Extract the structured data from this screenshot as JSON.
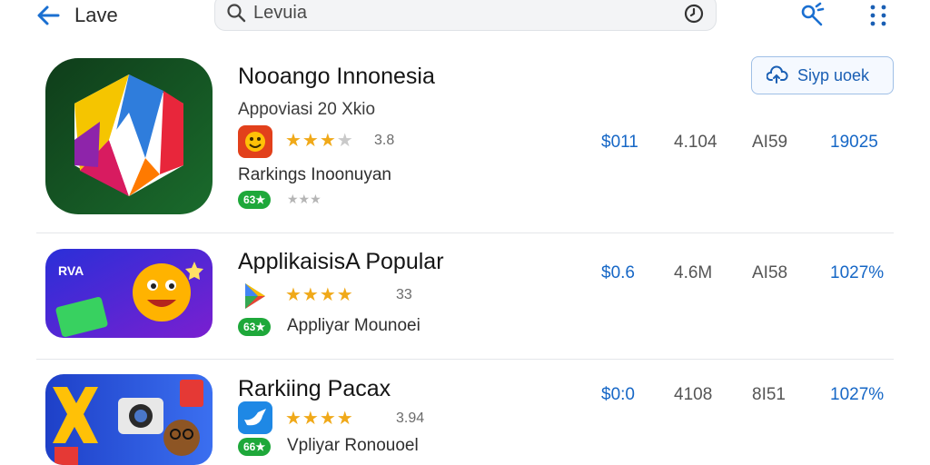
{
  "header": {
    "back_label": "Lave",
    "search": {
      "value": "Levuia",
      "placeholder": ""
    },
    "accent": "#1a6fd1"
  },
  "apps": [
    {
      "title": "Nooango Innonesia",
      "subtitle": "Appoviasi 20 Xkio",
      "rating": "3.8",
      "stars": 3.5,
      "line_label": "Rarkings Inoonuyan",
      "badge": "63★",
      "action_label": "Siyp uoek",
      "cells": {
        "price": "$011",
        "a": "4.104",
        "b": "AI59",
        "c": "19025"
      },
      "icon": "hexagon-w-app-icon",
      "mini_icon": "emoji-face-icon"
    },
    {
      "title": "ApplikaisisA Popular",
      "rating": "33",
      "stars": 4,
      "line_label": "Appliyar Mounoei",
      "badge": "63★",
      "cells": {
        "price": "$0.6",
        "a": "4.6M",
        "b": "AI58",
        "c": "1027%"
      },
      "icon": "rva-cartoon-app-icon",
      "icon_text": "RVA",
      "mini_icon": "play-store-icon"
    },
    {
      "title": "Rarkiing Pacax",
      "rating": "3.94",
      "stars": 4,
      "line_label": "Vpliyar Ronouoel",
      "badge": "66★",
      "cells": {
        "price": "$0:0",
        "a": "4108",
        "b": "8I51",
        "c": "1027%"
      },
      "icon": "camera-collage-app-icon",
      "mini_icon": "bird-icon"
    }
  ]
}
